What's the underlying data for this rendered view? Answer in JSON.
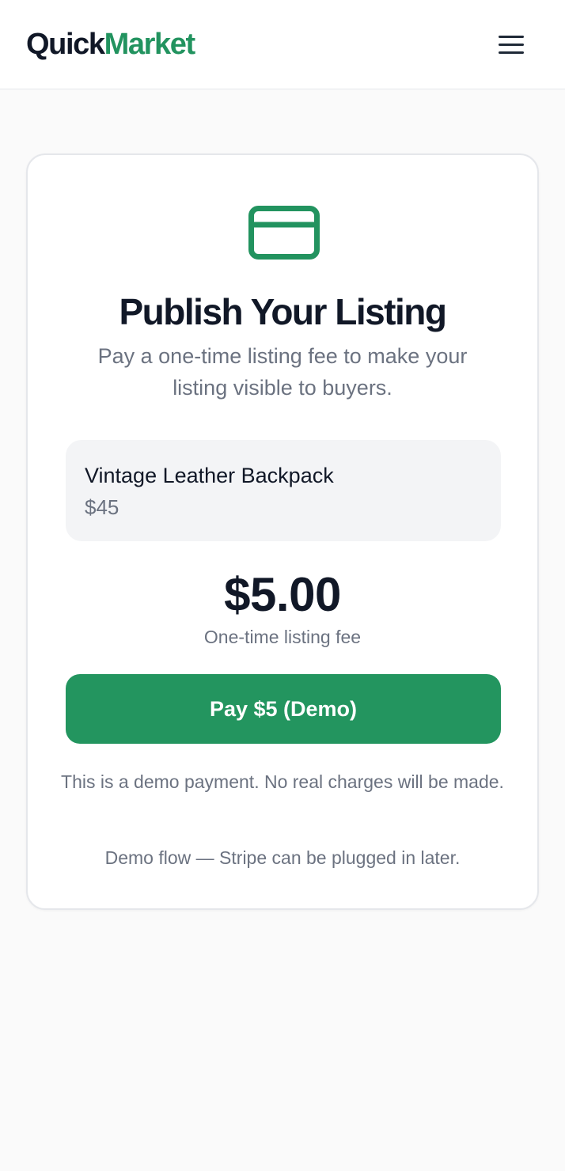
{
  "header": {
    "brand_part1": "Quick",
    "brand_part2": "Market",
    "menu_icon": "hamburger-menu-icon"
  },
  "colors": {
    "brand_green": "#22935f",
    "button_green": "#23955f",
    "text_dark": "#111827",
    "text_muted": "#6b7280",
    "item_bg": "#f3f4f6",
    "page_bg": "#fafafa"
  },
  "payment_card": {
    "icon": "credit-card-icon",
    "title": "Publish Your Listing",
    "subtitle": "Pay a one-time listing fee to make your listing visible to buyers.",
    "item": {
      "name": "Vintage Leather Backpack",
      "price": "$45"
    },
    "fee_amount": "$5.00",
    "fee_caption": "One-time listing fee",
    "pay_button_label": "Pay $5 (Demo)",
    "disclaimer": "This is a demo payment. No real charges will be made.",
    "demo_note": "Demo flow — Stripe can be plugged in later."
  }
}
